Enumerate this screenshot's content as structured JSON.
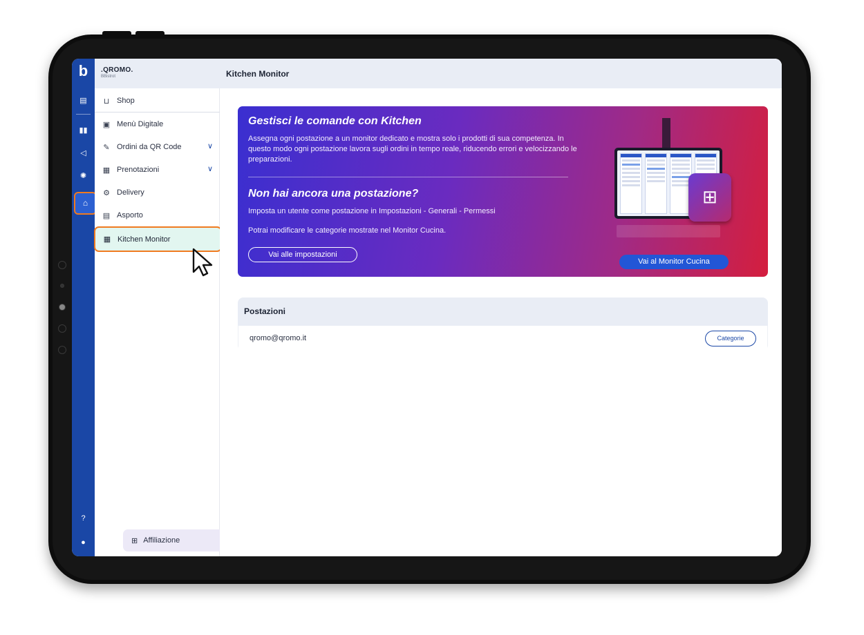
{
  "app": {
    "brand_name": ".QROMO.",
    "brand_sub": "BBistrot",
    "page_title": "Kitchen Monitor",
    "rail_logo": "b"
  },
  "rail": {
    "icons": [
      "menu-icon",
      "chart-icon",
      "megaphone-icon",
      "settings-icon",
      "kitchen-icon",
      "help-icon",
      "user-icon"
    ]
  },
  "sidebar": {
    "items": [
      {
        "label": "Shop",
        "icon": "cart-icon"
      },
      {
        "label": "Menù Digitale",
        "icon": "menu-book-icon"
      },
      {
        "label": "Ordini da QR Code",
        "icon": "qr-order-icon",
        "expandable": true
      },
      {
        "label": "Prenotazioni",
        "icon": "calendar-icon",
        "expandable": true
      },
      {
        "label": "Delivery",
        "icon": "delivery-icon"
      },
      {
        "label": "Asporto",
        "icon": "takeaway-icon"
      },
      {
        "label": "Kitchen Monitor",
        "icon": "monitor-icon",
        "active": true
      }
    ],
    "affiliation_label": "Affiliazione"
  },
  "banner": {
    "title": "Gestisci le comande con Kitchen",
    "text": "Assegna ogni postazione a un monitor dedicato e mostra solo i prodotti di sua competenza. In questo modo ogni postazione lavora sugli ordini in tempo reale, riducendo errori e velocizzando le preparazioni.",
    "title2": "Non hai ancora una postazione?",
    "text2": "Imposta un utente come postazione in Impostazioni - Generali - Permessi",
    "text3": "Potrai modificare le categorie mostrate nel Monitor Cucina.",
    "settings_button": "Vai alle impostazioni",
    "monitor_button": "Vai al Monitor Cucina"
  },
  "stations": {
    "title": "Postazioni",
    "rows": [
      {
        "email": "qromo@qromo.it",
        "action": "Categorie"
      }
    ]
  },
  "colors": {
    "primary": "#1a47a6",
    "highlight": "#f07a1f",
    "banner_start": "#3a2fd0",
    "banner_end": "#d41e3e"
  }
}
